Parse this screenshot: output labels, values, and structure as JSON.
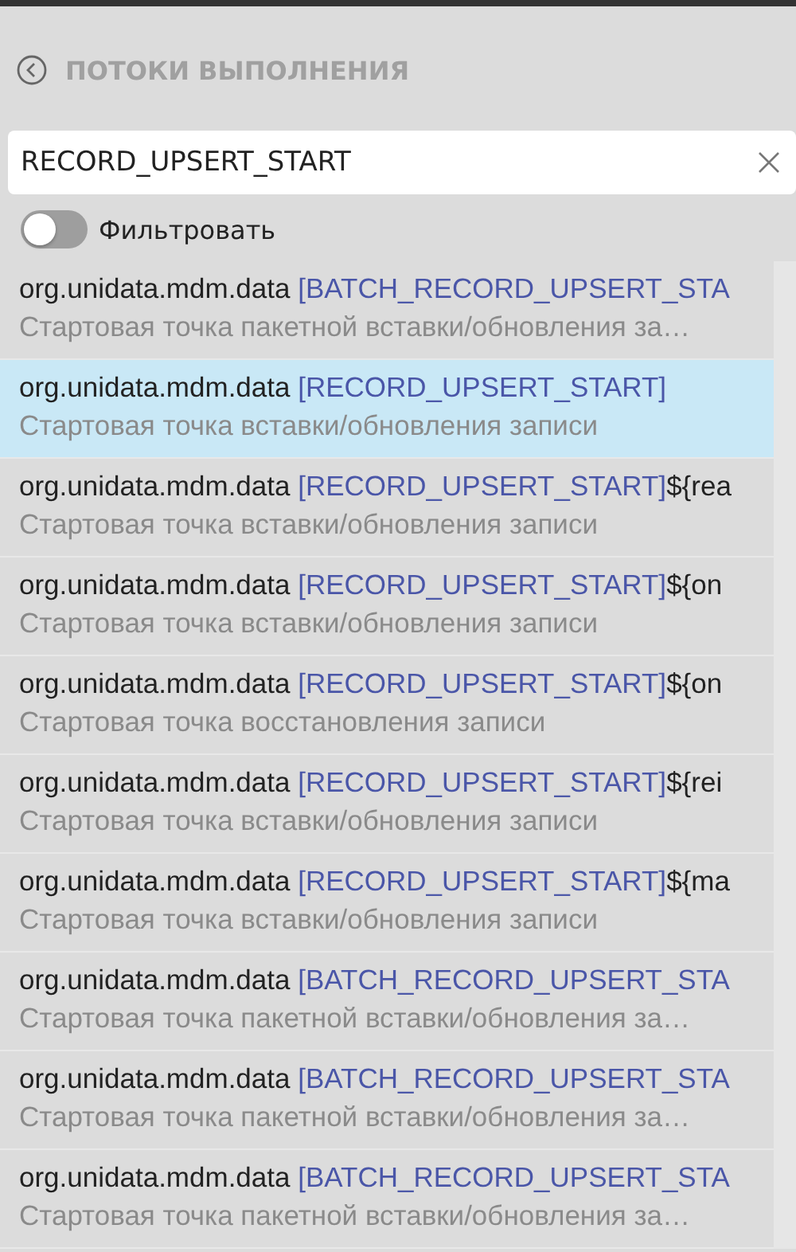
{
  "header": {
    "title": "ПОТОКИ ВЫПОЛНЕНИЯ"
  },
  "search": {
    "value": "RECORD_UPSERT_START"
  },
  "filter": {
    "label": "Фильтровать",
    "on": false
  },
  "items": [
    {
      "prefix": "org.unidata.mdm.data ",
      "tag": "[BATCH_RECORD_UPSERT_STA",
      "description": "Стартовая точка пакетной вставки/обновления за…",
      "selected": false
    },
    {
      "prefix": "org.unidata.mdm.data ",
      "tag": "[RECORD_UPSERT_START]",
      "description": "Стартовая точка вставки/обновления записи",
      "selected": true
    },
    {
      "prefix": "org.unidata.mdm.data ",
      "tag": "[RECORD_UPSERT_START]",
      "suffix": "${rea",
      "description": "Стартовая точка вставки/обновления записи",
      "selected": false
    },
    {
      "prefix": "org.unidata.mdm.data ",
      "tag": "[RECORD_UPSERT_START]",
      "suffix": "${on",
      "description": "Стартовая точка вставки/обновления записи",
      "selected": false
    },
    {
      "prefix": "org.unidata.mdm.data ",
      "tag": "[RECORD_UPSERT_START]",
      "suffix": "${on",
      "description": "Стартовая точка восстановления записи",
      "selected": false
    },
    {
      "prefix": "org.unidata.mdm.data ",
      "tag": "[RECORD_UPSERT_START]",
      "suffix": "${rei",
      "description": "Стартовая точка вставки/обновления записи",
      "selected": false
    },
    {
      "prefix": "org.unidata.mdm.data ",
      "tag": "[RECORD_UPSERT_START]",
      "suffix": "${ma",
      "description": "Стартовая точка вставки/обновления записи",
      "selected": false
    },
    {
      "prefix": "org.unidata.mdm.data ",
      "tag": "[BATCH_RECORD_UPSERT_STA",
      "description": "Стартовая точка пакетной вставки/обновления за…",
      "selected": false
    },
    {
      "prefix": "org.unidata.mdm.data ",
      "tag": "[BATCH_RECORD_UPSERT_STA",
      "description": "Стартовая точка пакетной вставки/обновления за…",
      "selected": false
    },
    {
      "prefix": "org.unidata.mdm.data ",
      "tag": "[BATCH_RECORD_UPSERT_STA",
      "description": "Стартовая точка пакетной вставки/обновления за…",
      "selected": false
    }
  ]
}
